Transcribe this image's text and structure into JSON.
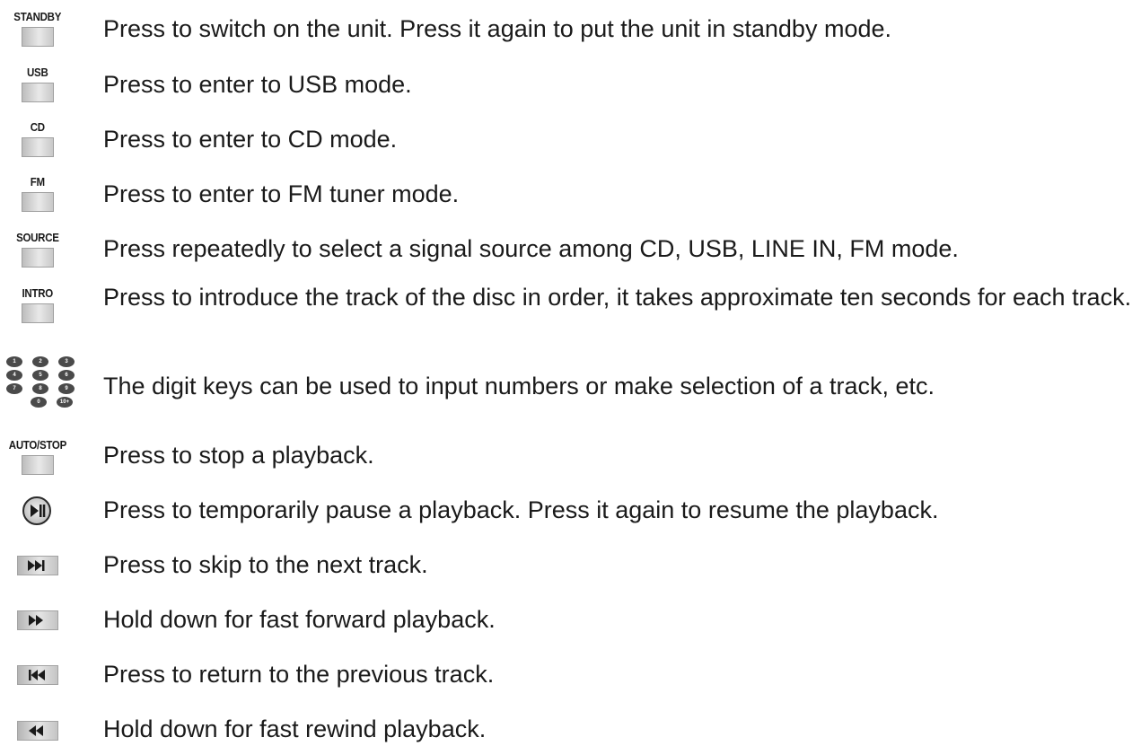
{
  "rows": [
    {
      "button": "STANDBY",
      "text": "Press to switch on the unit. Press it again to put the unit in standby mode."
    },
    {
      "button": "USB",
      "text": "Press to enter to USB mode."
    },
    {
      "button": "CD",
      "text": "Press to enter to CD mode."
    },
    {
      "button": "FM",
      "text": "Press to enter to FM tuner mode."
    },
    {
      "button": "SOURCE",
      "text": "Press repeatedly to select a signal source among CD, USB, LINE IN, FM mode."
    },
    {
      "button": "INTRO",
      "text": "Press to introduce the track of the disc in order, it takes approximate ten seconds for each track."
    },
    {
      "icon": "digit-keypad-icon",
      "keys": [
        "1",
        "2",
        "3",
        "4",
        "5",
        "6",
        "7",
        "8",
        "9",
        "0",
        "10+"
      ],
      "text": "The digit keys can be used to input numbers or make selection of a track, etc."
    },
    {
      "button": "AUTO/STOP",
      "text": "Press to stop a playback."
    },
    {
      "icon": "play-pause-icon",
      "text": "Press to temporarily pause a playback. Press it again to resume the playback."
    },
    {
      "icon": "skip-next-icon",
      "text": "Press to skip to the next track."
    },
    {
      "icon": "fast-forward-icon",
      "text": "Hold down for fast forward playback."
    },
    {
      "icon": "skip-previous-icon",
      "text": "Press to return to the previous track."
    },
    {
      "icon": "fast-rewind-icon",
      "text": "Hold down for fast rewind playback."
    }
  ],
  "colors": {
    "text": "#1a1a1a",
    "key_gradient_light": "#e9e9e9",
    "key_gradient_dark": "#bdbdbd",
    "digit_key": "#4a4a4a"
  }
}
